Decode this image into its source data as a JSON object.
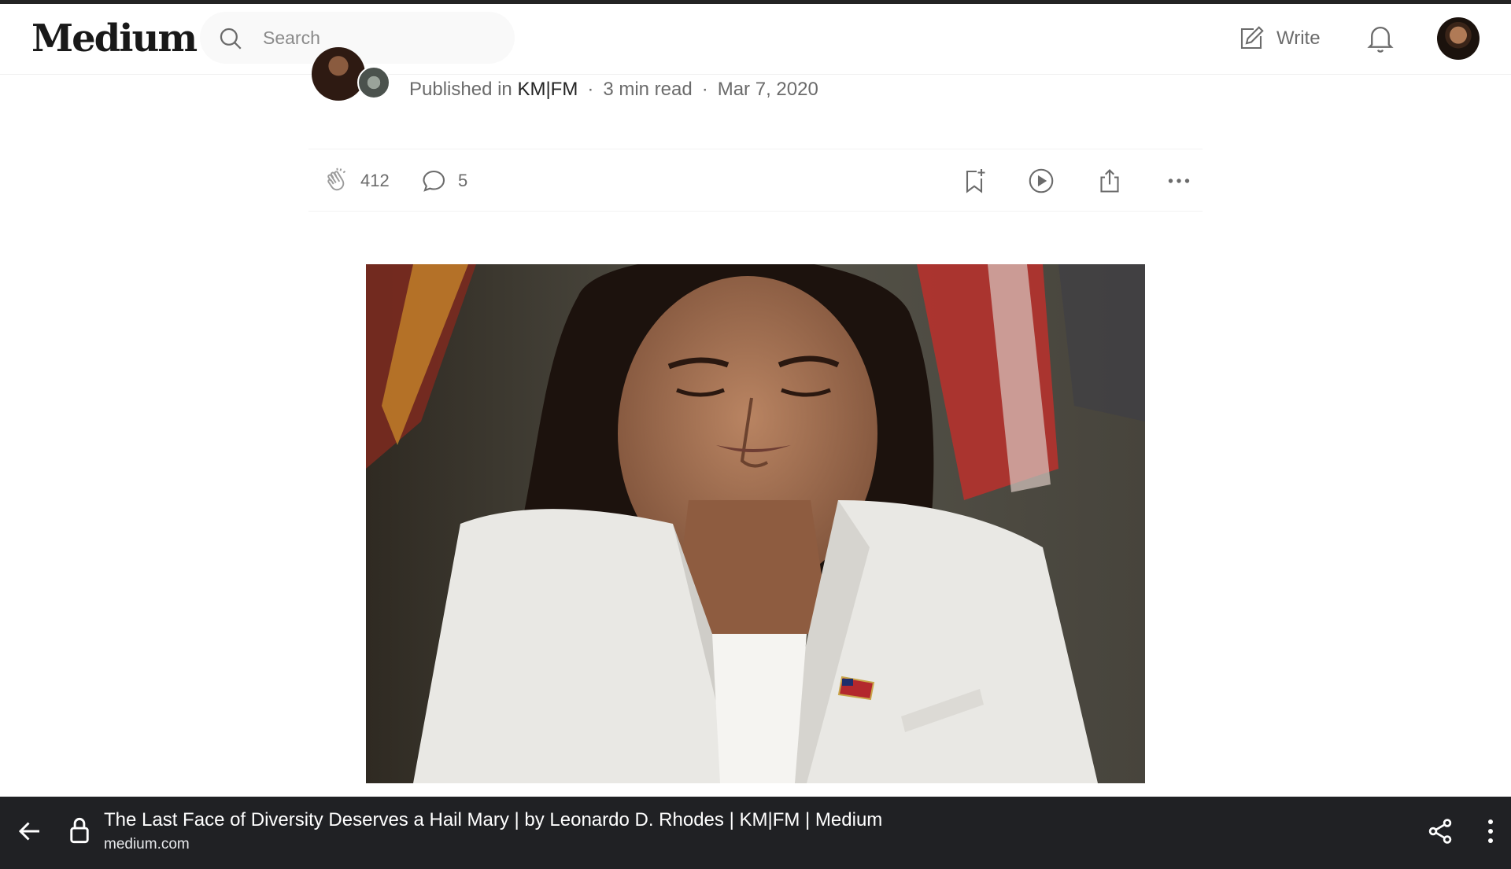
{
  "header": {
    "logo": "Medium",
    "search_placeholder": "Search",
    "write_label": "Write"
  },
  "article": {
    "published_prefix": "Published in",
    "publication": "KM|FM",
    "read_time": "3 min read",
    "date": "Mar 7, 2020",
    "separator": "·"
  },
  "actions": {
    "claps": "412",
    "comments": "5"
  },
  "browser": {
    "page_title": "The Last Face of Diversity Deserves a Hail Mary | by Leonardo D. Rhodes | KM|FM | Medium",
    "domain": "medium.com"
  },
  "colors": {
    "text_primary": "#242424",
    "text_secondary": "#6b6b6b",
    "bottom_bar": "#202124",
    "search_bg": "#f9f9f9"
  },
  "icons": [
    "search-icon",
    "write-icon",
    "bell-icon",
    "clap-icon",
    "comment-icon",
    "bookmark-add-icon",
    "play-icon",
    "share-icon",
    "more-icon",
    "back-arrow-icon",
    "lock-icon",
    "share-nodes-icon",
    "vertical-dots-icon"
  ]
}
